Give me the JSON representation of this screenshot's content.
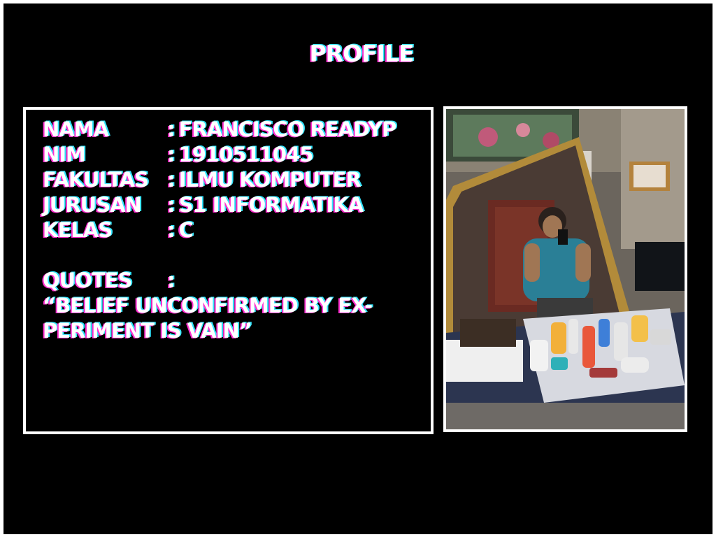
{
  "title": "PROFILE",
  "profile": {
    "rows": [
      {
        "label": "NAMA",
        "value": "FRANCISCO READYP"
      },
      {
        "label": "NIM",
        "value": "1910511045"
      },
      {
        "label": "FAKULTAS",
        "value": "ILMU KOMPUTER"
      },
      {
        "label": "JURUSAN",
        "value": "S1 INFORMATIKA"
      },
      {
        "label": "KELAS",
        "value": "C"
      }
    ],
    "colon": ":",
    "quotes_label": "QUOTES",
    "quote_text": "“BELIEF UNCONFIRMED BY EX-PERIMENT IS VAIN”"
  },
  "colors": {
    "background": "#000000",
    "text": "#ffffff",
    "shadow_magenta": "#ff2fd0",
    "shadow_cyan": "#33e6ff"
  }
}
